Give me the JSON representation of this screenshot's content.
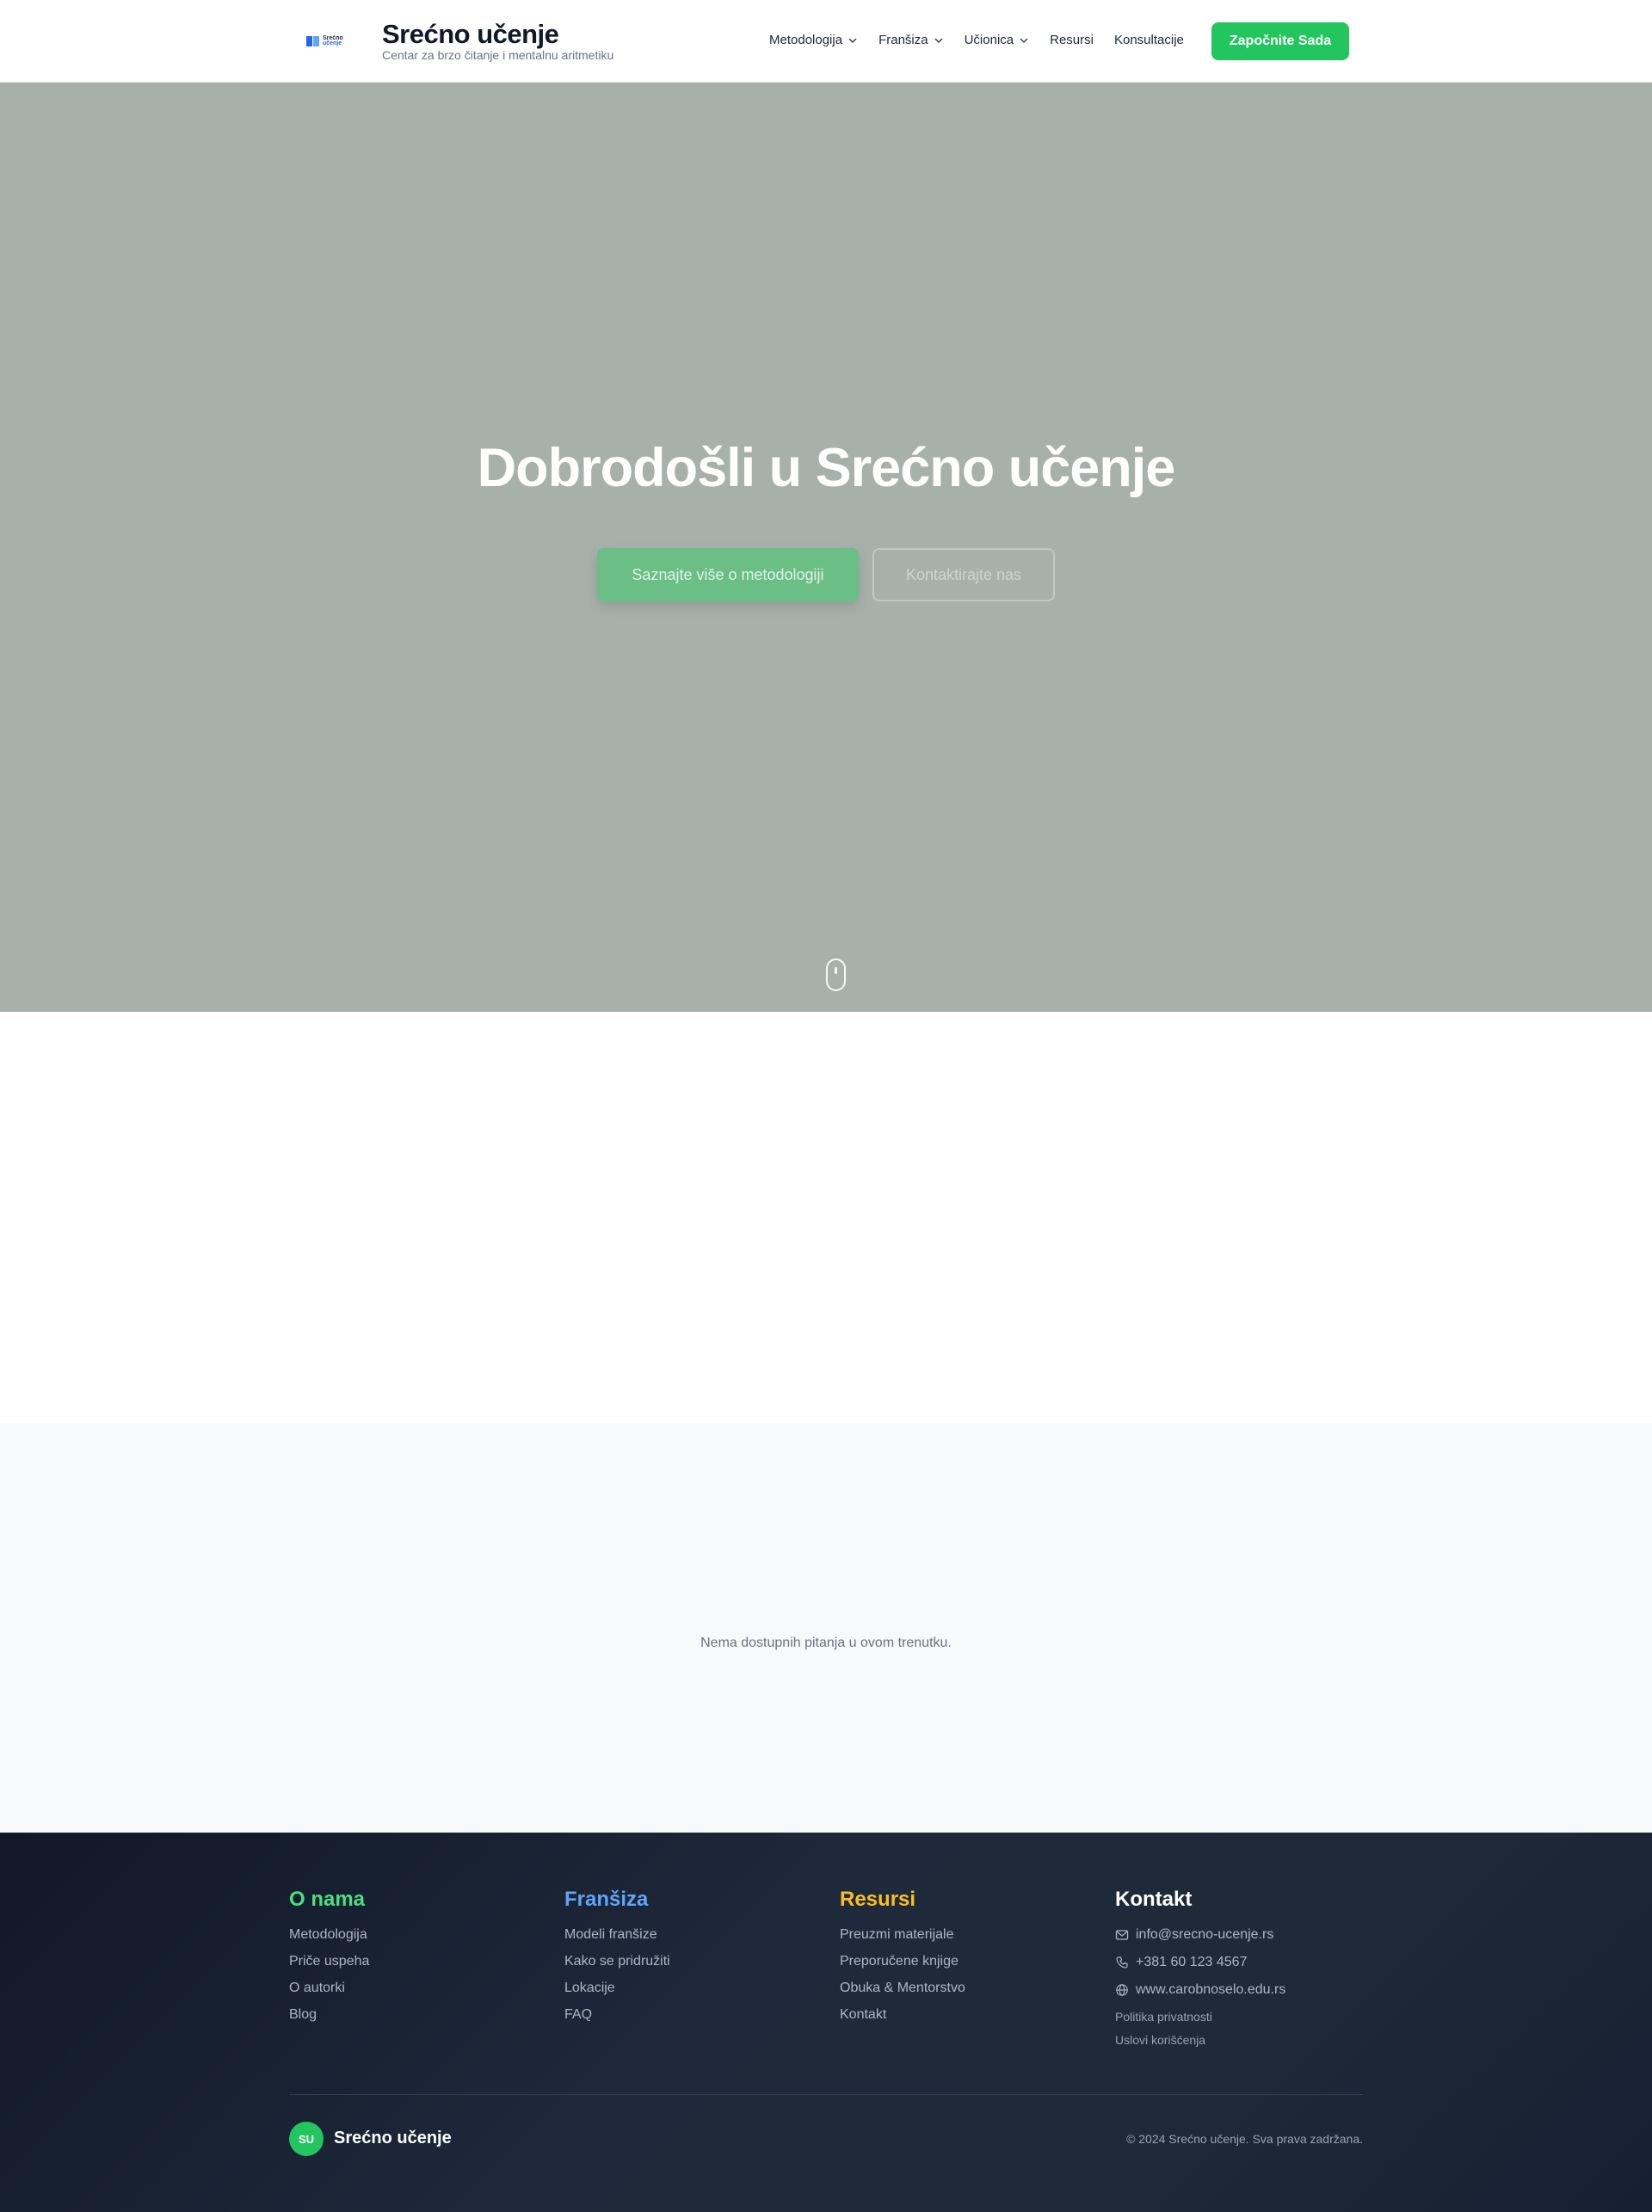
{
  "header": {
    "logo_text_1": "Srećno",
    "logo_text_2": "učenje",
    "title": "Srećno učenje",
    "subtitle": "Centar za brzo čitanje i mentalnu aritmetiku",
    "nav": [
      {
        "label": "Metodologija",
        "dropdown": true
      },
      {
        "label": "Franšiza",
        "dropdown": true
      },
      {
        "label": "Učionica",
        "dropdown": true
      },
      {
        "label": "Resursi",
        "dropdown": false
      },
      {
        "label": "Konsultacije",
        "dropdown": false
      }
    ],
    "cta_label": "Započnite Sada"
  },
  "hero": {
    "title": "Dobrodošli u Srećno učenje",
    "primary_button": "Saznajte više o metodologiji",
    "secondary_button": "Kontaktirajte nas"
  },
  "faq": {
    "empty_message": "Nema dostupnih pitanja u ovom trenutku."
  },
  "footer": {
    "columns": [
      {
        "title": "O nama",
        "links": [
          "Metodologija",
          "Priče uspeha",
          "O autorki",
          "Blog"
        ]
      },
      {
        "title": "Franšiza",
        "links": [
          "Modeli franšize",
          "Kako se pridružiti",
          "Lokacije",
          "FAQ"
        ]
      },
      {
        "title": "Resursi",
        "links": [
          "Preuzmi materijale",
          "Preporučene knjige",
          "Obuka & Mentorstvo",
          "Kontakt"
        ]
      }
    ],
    "contact": {
      "title": "Kontakt",
      "email": "info@srecno-ucenje.rs",
      "phone": "+381 60 123 4567",
      "website": "www.carobnoselo.edu.rs",
      "privacy": "Politika privatnosti",
      "terms": "Uslovi korišćenja"
    },
    "badge": "SU",
    "brand": "Srećno učenje",
    "copyright": "© 2024 Srećno učenje. Sva prava zadržana."
  },
  "colors": {
    "accent": "#22c55e",
    "hero_bg": "#a7b0aa",
    "footer_bg": "#1e293b"
  }
}
